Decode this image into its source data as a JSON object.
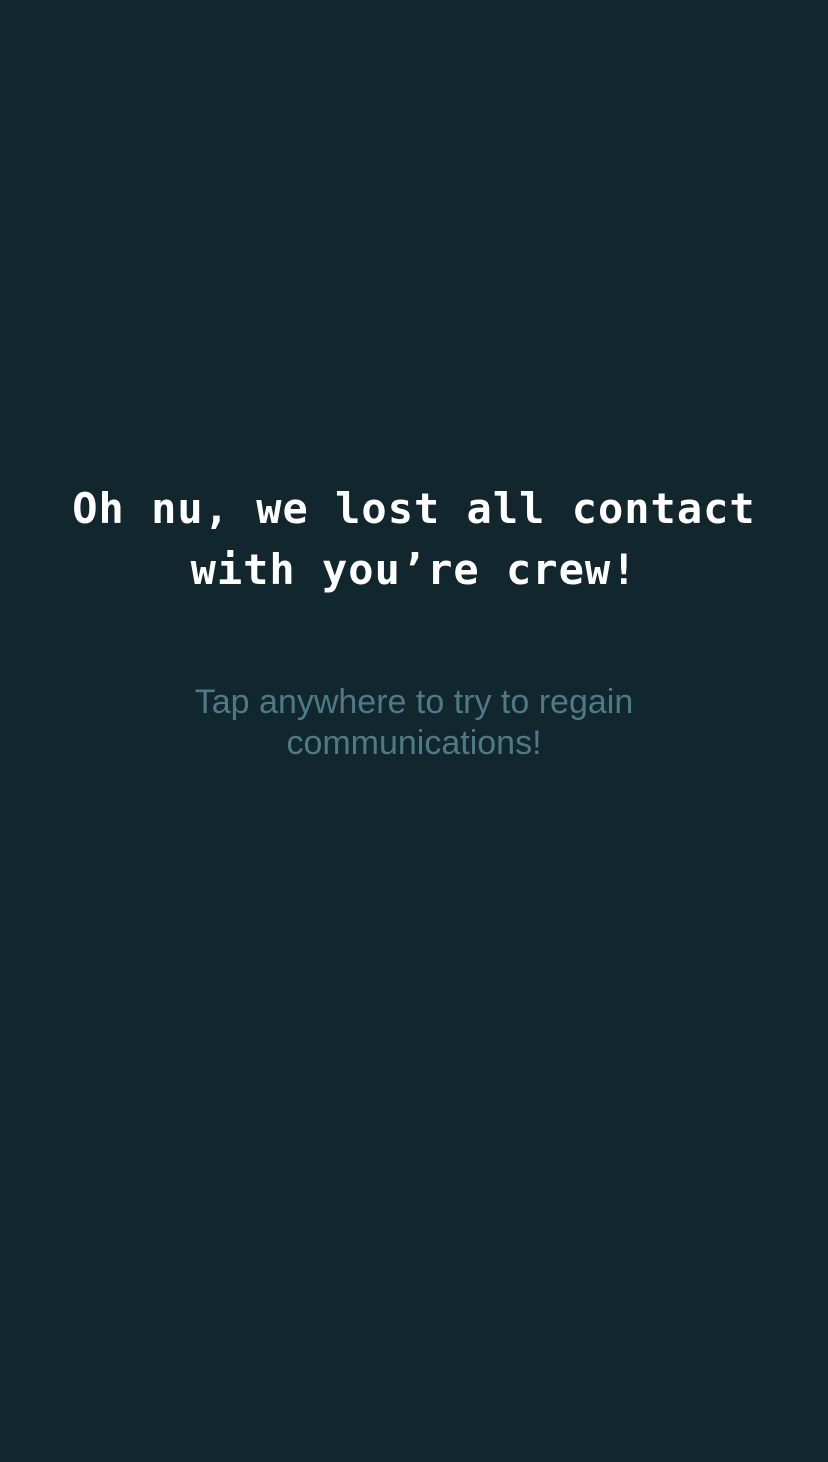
{
  "screen": {
    "headline": "Oh nu, we lost all contact\nwith you’re crew!",
    "hint": "Tap anywhere to try to regain\ncommunications!",
    "colors": {
      "background": "#11262d",
      "headline": "#ffffff",
      "hint": "#4d7a86"
    }
  }
}
